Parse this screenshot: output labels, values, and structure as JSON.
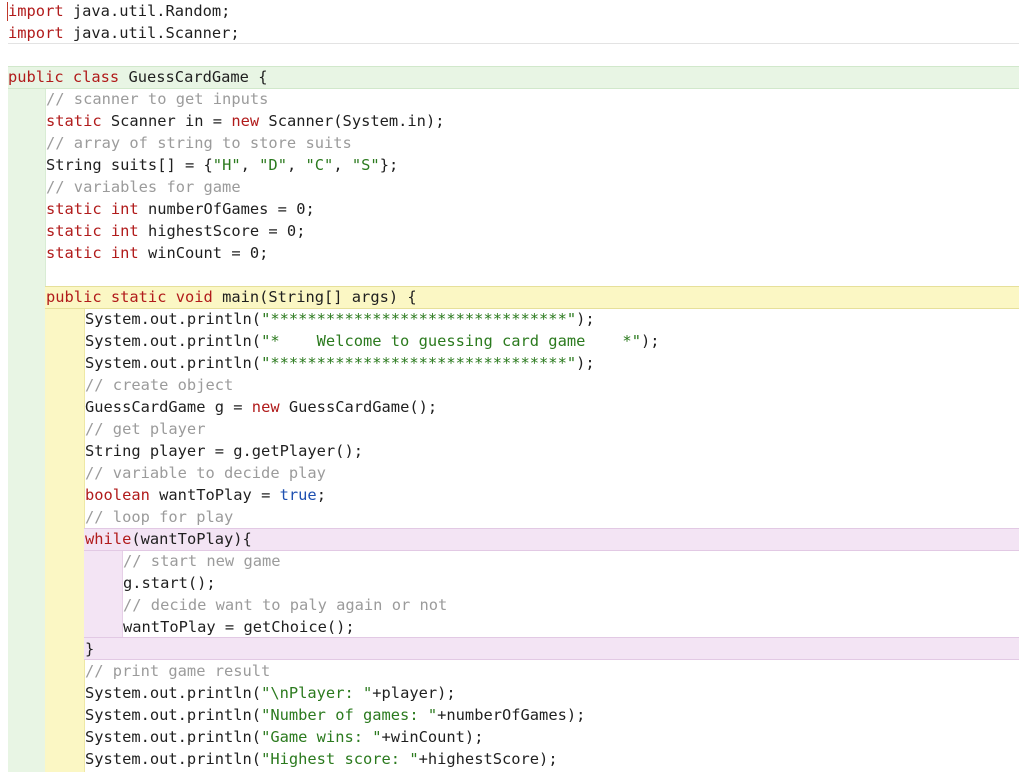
{
  "editor": {
    "lines": [
      [
        {
          "t": "import",
          "c": "kw"
        },
        {
          "t": " java.util.Random;"
        }
      ],
      [
        {
          "t": "import",
          "c": "kw"
        },
        {
          "t": " java.util.Scanner;"
        }
      ],
      [],
      [
        {
          "t": "public class",
          "c": "kw"
        },
        {
          "t": " GuessCardGame {"
        }
      ],
      [
        {
          "t": "// scanner to get inputs",
          "c": "cmt"
        }
      ],
      [
        {
          "t": "static",
          "c": "kw"
        },
        {
          "t": " Scanner in = "
        },
        {
          "t": "new",
          "c": "kw"
        },
        {
          "t": " Scanner(System.in);"
        }
      ],
      [
        {
          "t": "// array of string to store suits",
          "c": "cmt"
        }
      ],
      [
        {
          "t": "String suits[] = {"
        },
        {
          "t": "\"H\"",
          "c": "str"
        },
        {
          "t": ", "
        },
        {
          "t": "\"D\"",
          "c": "str"
        },
        {
          "t": ", "
        },
        {
          "t": "\"C\"",
          "c": "str"
        },
        {
          "t": ", "
        },
        {
          "t": "\"S\"",
          "c": "str"
        },
        {
          "t": "};"
        }
      ],
      [
        {
          "t": "// variables for game",
          "c": "cmt"
        }
      ],
      [
        {
          "t": "static int",
          "c": "kw"
        },
        {
          "t": " numberOfGames = 0;"
        }
      ],
      [
        {
          "t": "static int",
          "c": "kw"
        },
        {
          "t": " highestScore = 0;"
        }
      ],
      [
        {
          "t": "static int",
          "c": "kw"
        },
        {
          "t": " winCount = 0;"
        }
      ],
      [],
      [
        {
          "t": "public static void",
          "c": "kw"
        },
        {
          "t": " main(String[] args) {"
        }
      ],
      [
        {
          "t": "System.out.println("
        },
        {
          "t": "\"********************************\"",
          "c": "str"
        },
        {
          "t": ");"
        }
      ],
      [
        {
          "t": "System.out.println("
        },
        {
          "t": "\"*    Welcome to guessing card game    *\"",
          "c": "str"
        },
        {
          "t": ");"
        }
      ],
      [
        {
          "t": "System.out.println("
        },
        {
          "t": "\"********************************\"",
          "c": "str"
        },
        {
          "t": ");"
        }
      ],
      [
        {
          "t": "// create object",
          "c": "cmt"
        }
      ],
      [
        {
          "t": "GuessCardGame g = "
        },
        {
          "t": "new",
          "c": "kw"
        },
        {
          "t": " GuessCardGame();"
        }
      ],
      [
        {
          "t": "// get player",
          "c": "cmt"
        }
      ],
      [
        {
          "t": "String player = g.getPlayer();"
        }
      ],
      [
        {
          "t": "// variable to decide play",
          "c": "cmt"
        }
      ],
      [
        {
          "t": "boolean",
          "c": "kw"
        },
        {
          "t": " wantToPlay = "
        },
        {
          "t": "true",
          "c": "bool"
        },
        {
          "t": ";"
        }
      ],
      [
        {
          "t": "// loop for play",
          "c": "cmt"
        }
      ],
      [
        {
          "t": "while",
          "c": "kw"
        },
        {
          "t": "(wantToPlay){"
        }
      ],
      [
        {
          "t": "// start new game",
          "c": "cmt"
        }
      ],
      [
        {
          "t": "g.start();"
        }
      ],
      [
        {
          "t": "// decide want to paly again or not",
          "c": "cmt"
        }
      ],
      [
        {
          "t": "wantToPlay = getChoice();"
        }
      ],
      [
        {
          "t": "}"
        }
      ],
      [
        {
          "t": "// print game result",
          "c": "cmt"
        }
      ],
      [
        {
          "t": "System.out.println("
        },
        {
          "t": "\"\\nPlayer: \"",
          "c": "str"
        },
        {
          "t": "+player);"
        }
      ],
      [
        {
          "t": "System.out.println("
        },
        {
          "t": "\"Number of games: \"",
          "c": "str"
        },
        {
          "t": "+numberOfGames);"
        }
      ],
      [
        {
          "t": "System.out.println("
        },
        {
          "t": "\"Game wins: \"",
          "c": "str"
        },
        {
          "t": "+winCount);"
        }
      ],
      [
        {
          "t": "System.out.println("
        },
        {
          "t": "\"Highest score: \"",
          "c": "str"
        },
        {
          "t": "+highestScore);"
        }
      ]
    ]
  },
  "colors": {
    "keyword": "#b11b1b",
    "string": "#2b7a1e",
    "comment": "#9b9b9b",
    "boolean_literal": "#1d4fb0",
    "class_scope": "#e8f5e4",
    "method_scope": "#fbf7c4",
    "loop_scope": "#f3e4f4"
  }
}
